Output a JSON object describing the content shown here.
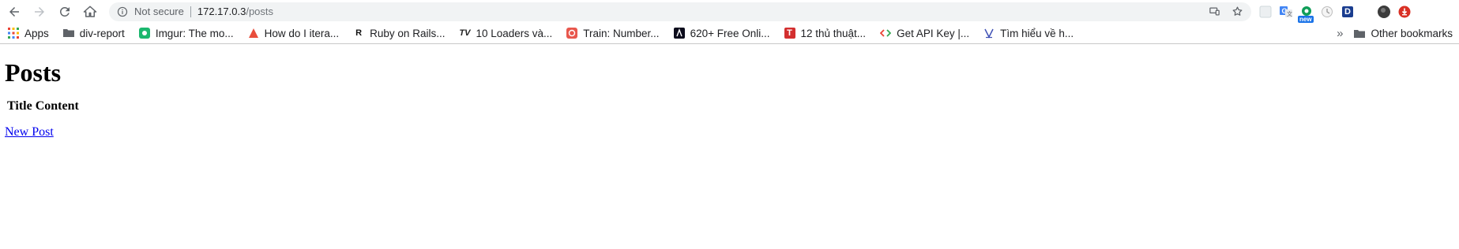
{
  "browser": {
    "security_label": "Not secure",
    "url_host": "172.17.0.3",
    "url_path": "/posts",
    "extensions": [
      {
        "icon": "grid-extension-icon"
      },
      {
        "icon": "google-translate-icon"
      },
      {
        "icon": "new-extension-icon",
        "badge": "new"
      },
      {
        "icon": "timer-extension-icon"
      },
      {
        "icon": "d-extension-icon",
        "letter": "D"
      },
      {
        "icon": "profile-avatar-icon"
      },
      {
        "icon": "adblock-icon"
      }
    ]
  },
  "bookmarks": {
    "items": [
      {
        "label": "Apps",
        "icon": "apps-grid-icon"
      },
      {
        "label": "div-report",
        "icon": "folder-icon"
      },
      {
        "label": "Imgur: The mo...",
        "icon": "imgur-icon"
      },
      {
        "label": "How do I itera...",
        "icon": "red-triangle-icon"
      },
      {
        "label": "Ruby on Rails...",
        "icon": "rails-r-icon"
      },
      {
        "label": "10 Loaders và...",
        "icon": "tv-icon"
      },
      {
        "label": "Train: Number...",
        "icon": "red-swirl-icon"
      },
      {
        "label": "620+ Free Onli...",
        "icon": "dark-a-icon"
      },
      {
        "label": "12 thủ thuật...",
        "icon": "red-t-icon"
      },
      {
        "label": "Get API Key |...",
        "icon": "code-brackets-icon"
      },
      {
        "label": "Tìm hiểu về h...",
        "icon": "v-icon"
      }
    ],
    "overflow": "»",
    "other": "Other bookmarks"
  },
  "page": {
    "heading": "Posts",
    "table_headers": [
      "Title",
      "Content"
    ],
    "new_post_link": "New Post"
  }
}
